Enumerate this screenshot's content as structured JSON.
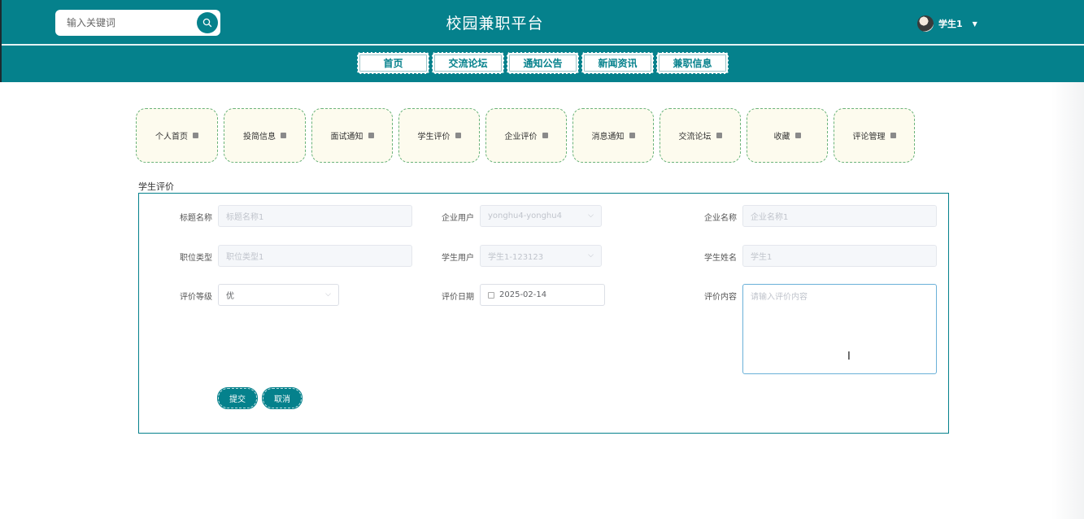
{
  "header": {
    "search_placeholder": "输入关键词",
    "site_title": "校园兼职平台",
    "user_name": "学生1"
  },
  "nav": {
    "items": [
      "首页",
      "交流论坛",
      "通知公告",
      "新闻资讯",
      "兼职信息"
    ]
  },
  "submenu": {
    "items": [
      "个人首页",
      "投简信息",
      "面试通知",
      "学生评价",
      "企业评价",
      "消息通知",
      "交流论坛",
      "收藏",
      "评论管理"
    ]
  },
  "section_title": "学生评价",
  "form": {
    "title_name": {
      "label": "标题名称",
      "value": "标题名称1"
    },
    "company_user": {
      "label": "企业用户",
      "value": "yonghu4-yonghu4"
    },
    "company_name": {
      "label": "企业名称",
      "value": "企业名称1"
    },
    "job_type": {
      "label": "职位类型",
      "value": "职位类型1"
    },
    "student_user": {
      "label": "学生用户",
      "value": "学生1-123123"
    },
    "student_name": {
      "label": "学生姓名",
      "value": "学生1"
    },
    "rating_level": {
      "label": "评价等级",
      "value": "优"
    },
    "rating_date": {
      "label": "评价日期",
      "value": "2025-02-14"
    },
    "rating_content": {
      "label": "评价内容",
      "placeholder": "请输入评价内容"
    },
    "submit_label": "提交",
    "cancel_label": "取消"
  },
  "colors": {
    "primary": "#05818c",
    "submenu_bg": "#fdfbee",
    "submenu_border": "#6ab37a"
  }
}
